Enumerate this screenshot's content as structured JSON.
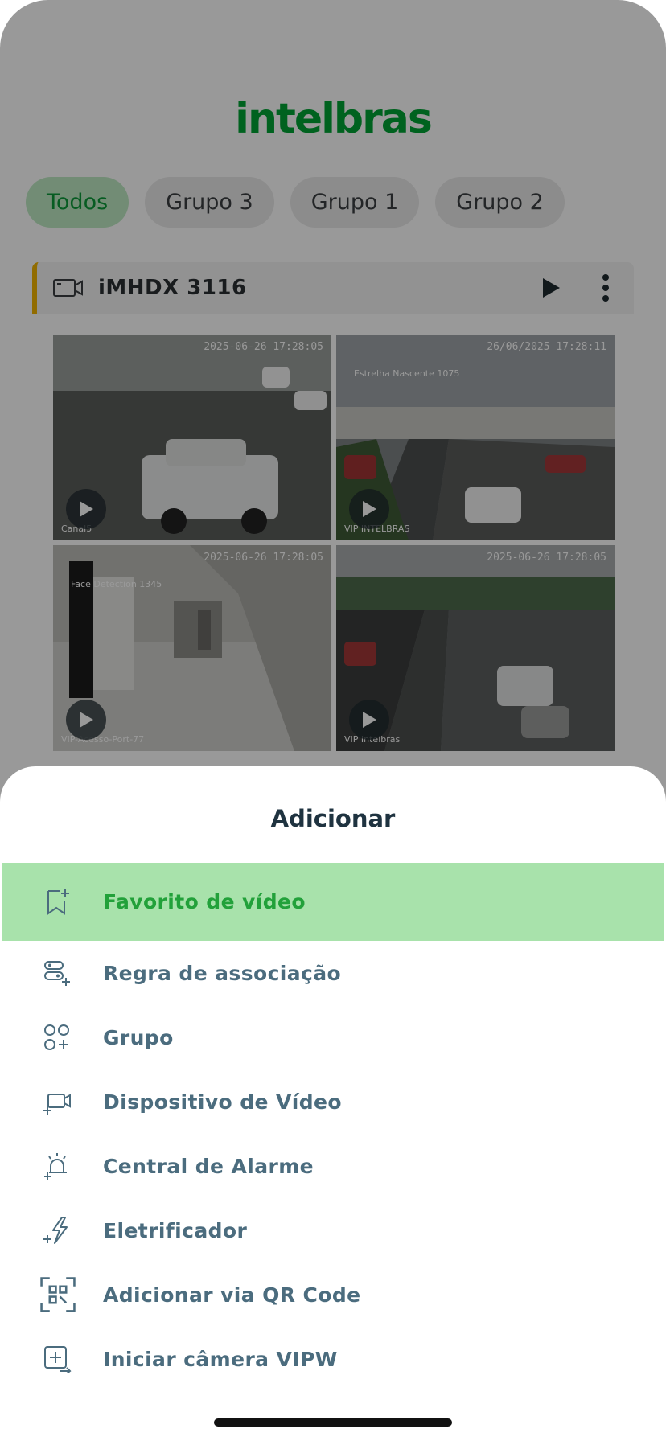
{
  "brand": {
    "logo_text": "intelbras",
    "accent": "#00a335"
  },
  "groups": [
    {
      "label": "Todos",
      "active": true
    },
    {
      "label": "Grupo 3",
      "active": false
    },
    {
      "label": "Grupo 1",
      "active": false
    },
    {
      "label": "Grupo 2",
      "active": false
    }
  ],
  "device": {
    "name": "iMHDX 3116",
    "icon": "camera-icon",
    "cameras": [
      {
        "timestamp": "2025-06-26 17:28:05",
        "label": "Canal5",
        "caption": ""
      },
      {
        "timestamp": "26/06/2025 17:28:11",
        "label": "VIP INTELBRAS",
        "caption": "Estrelha Nascente 1075"
      },
      {
        "timestamp": "2025-06-26 17:28:05",
        "label": "VIP-Acesso-Port-77",
        "caption": "Face Detection 1345"
      },
      {
        "timestamp": "2025-06-26 17:28:05",
        "label": "VIP Intelbras",
        "caption": ""
      }
    ]
  },
  "sheet": {
    "title": "Adicionar",
    "items": [
      {
        "label": "Favorito de vídeo",
        "icon": "bookmark-add-icon",
        "selected": true
      },
      {
        "label": "Regra de associação",
        "icon": "association-rule-icon",
        "selected": false
      },
      {
        "label": "Grupo",
        "icon": "group-add-icon",
        "selected": false
      },
      {
        "label": "Dispositivo de Vídeo",
        "icon": "video-device-add-icon",
        "selected": false
      },
      {
        "label": "Central de Alarme",
        "icon": "alarm-add-icon",
        "selected": false
      },
      {
        "label": "Eletrificador",
        "icon": "electrifier-add-icon",
        "selected": false
      },
      {
        "label": "Adicionar via QR Code",
        "icon": "qr-code-icon",
        "selected": false
      },
      {
        "label": "Iniciar câmera VIPW",
        "icon": "camera-start-icon",
        "selected": false
      }
    ]
  }
}
